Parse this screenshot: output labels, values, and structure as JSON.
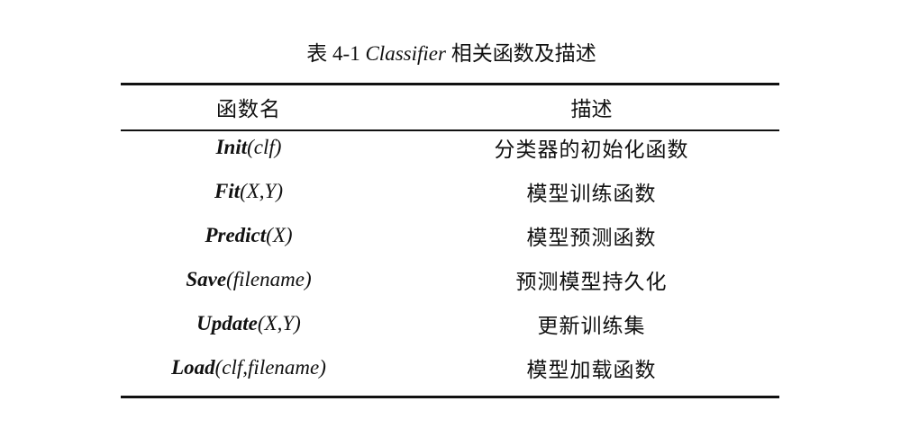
{
  "caption": {
    "prefix": "表 4-1 ",
    "name": "Classifier",
    "suffix": " 相关函数及描述"
  },
  "header": {
    "col_name": "函数名",
    "col_desc": "描述"
  },
  "rows": [
    {
      "name": "Init",
      "args": "(clf)",
      "desc": "分类器的初始化函数"
    },
    {
      "name": "Fit",
      "args": "(X,Y)",
      "desc": "模型训练函数"
    },
    {
      "name": "Predict",
      "args": "(X)",
      "desc": "模型预测函数"
    },
    {
      "name": "Save",
      "args": "(filename)",
      "desc": "预测模型持久化"
    },
    {
      "name": "Update",
      "args": "(X,Y)",
      "desc": "更新训练集"
    },
    {
      "name": "Load",
      "args": "(clf,filename)",
      "desc": "模型加载函数"
    }
  ]
}
